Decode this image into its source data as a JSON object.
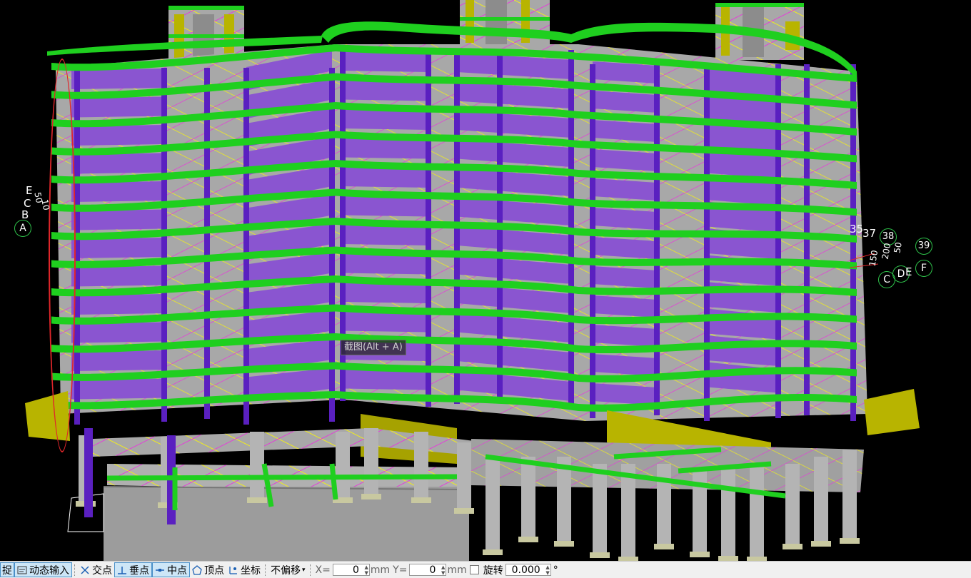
{
  "tooltip": "截图(Alt + A)",
  "axis_left": {
    "labels": [
      "E",
      "C",
      "B",
      "A"
    ],
    "numbers": [
      "50",
      "10"
    ]
  },
  "axis_right": {
    "top_numbers": [
      "35",
      "37",
      "38",
      "39"
    ],
    "vertical_numbers": [
      "150",
      "200",
      "50"
    ],
    "letters": [
      "C",
      "D",
      "E",
      "F"
    ]
  },
  "statusbar": {
    "capture_label": "捉",
    "dynamic_input_label": "动态输入",
    "intersection_label": "交点",
    "perpendicular_label": "垂点",
    "midpoint_label": "中点",
    "vertex_label": "顶点",
    "coordinate_label": "坐标",
    "offset_mode": "不偏移",
    "x_label": "X=",
    "x_value": "0",
    "x_unit": "mm",
    "y_label": "Y=",
    "y_value": "0",
    "y_unit": "mm",
    "rotate_label": "旋转",
    "rotate_value": "0.000",
    "degree_symbol": "°"
  },
  "colors": {
    "slab_green": "#1fcf1f",
    "wall_purple": "#8a55d0",
    "floor_gray": "#a8a8a8",
    "column_violet": "#5a20c0",
    "yellow_beam": "#b8b400",
    "annotation_red": "#e0262a",
    "background": "#000000"
  }
}
